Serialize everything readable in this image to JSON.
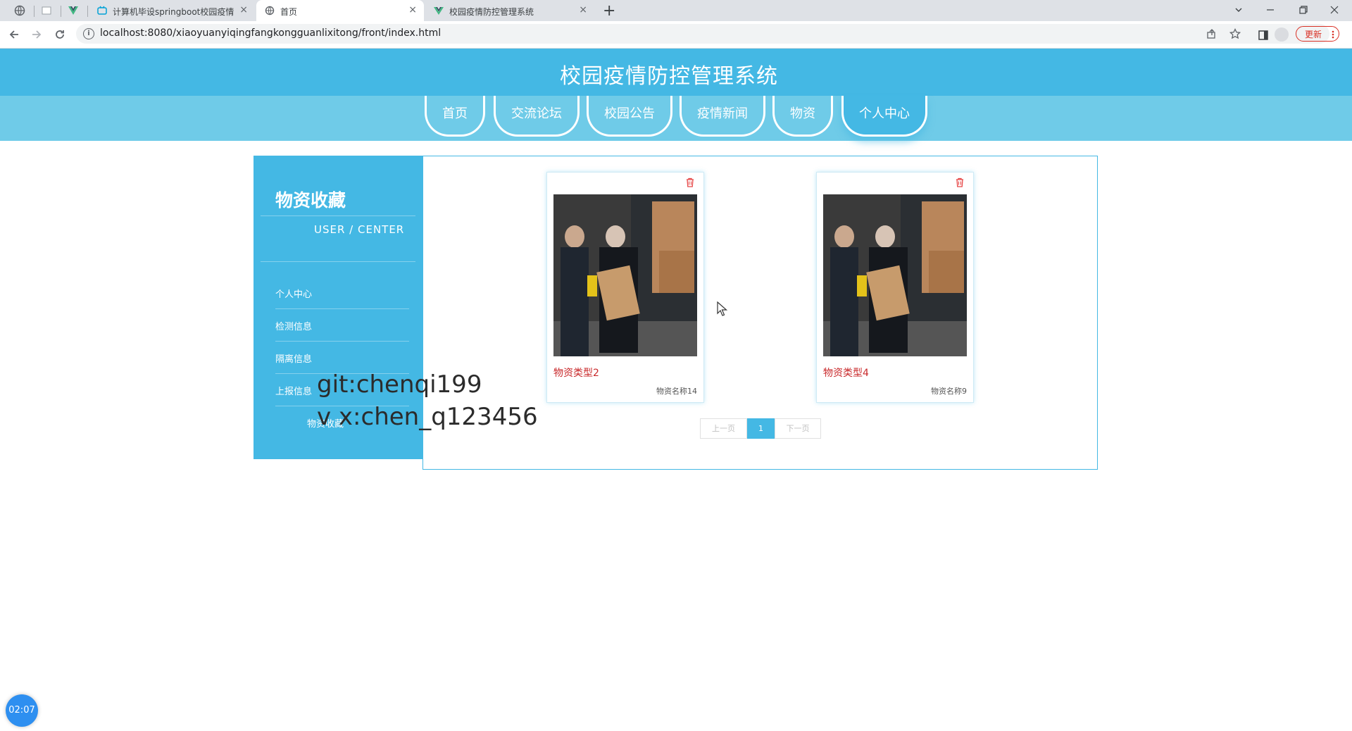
{
  "browser": {
    "tabs": [
      {
        "title": "计算机毕设springboot校园疫情",
        "active": false
      },
      {
        "title": "首页",
        "active": true
      },
      {
        "title": "校园疫情防控管理系统",
        "active": false
      }
    ],
    "close_glyph": "×",
    "new_tab_glyph": "+",
    "url": "localhost:8080/xiaoyuanyiqingfangkongguanlixitong/front/index.html",
    "update_label": "更新"
  },
  "header": {
    "site_title": "校园疫情防控管理系统",
    "nav": [
      {
        "label": "首页",
        "active": false
      },
      {
        "label": "交流论坛",
        "active": false
      },
      {
        "label": "校园公告",
        "active": false
      },
      {
        "label": "疫情新闻",
        "active": false
      },
      {
        "label": "物资",
        "active": false
      },
      {
        "label": "个人中心",
        "active": true
      }
    ]
  },
  "sidebar": {
    "title": "物资收藏",
    "subtitle": "USER / CENTER",
    "items": [
      {
        "label": "个人中心"
      },
      {
        "label": "检测信息"
      },
      {
        "label": "隔离信息"
      },
      {
        "label": "上报信息"
      },
      {
        "label": "物资收藏"
      }
    ]
  },
  "cards": [
    {
      "type_label": "物资类型2",
      "name_label": "物资名称14",
      "image": "workers-unloading-boxes-photo",
      "delete_icon": "trash-icon"
    },
    {
      "type_label": "物资类型4",
      "name_label": "物资名称9",
      "image": "workers-unloading-boxes-photo",
      "delete_icon": "trash-icon"
    }
  ],
  "pagination": {
    "prev_label": "上一页",
    "current_page": "1",
    "next_label": "下一页"
  },
  "overlay": {
    "watermark_line1": "git:chenqi199",
    "watermark_line2": "v x:chen_q123456",
    "timer": "02:07"
  },
  "colors": {
    "brand": "#44b8e4",
    "nav_band": "#6fcbe8",
    "card_type_text": "#c8282a",
    "delete_icon": "#e64545"
  }
}
